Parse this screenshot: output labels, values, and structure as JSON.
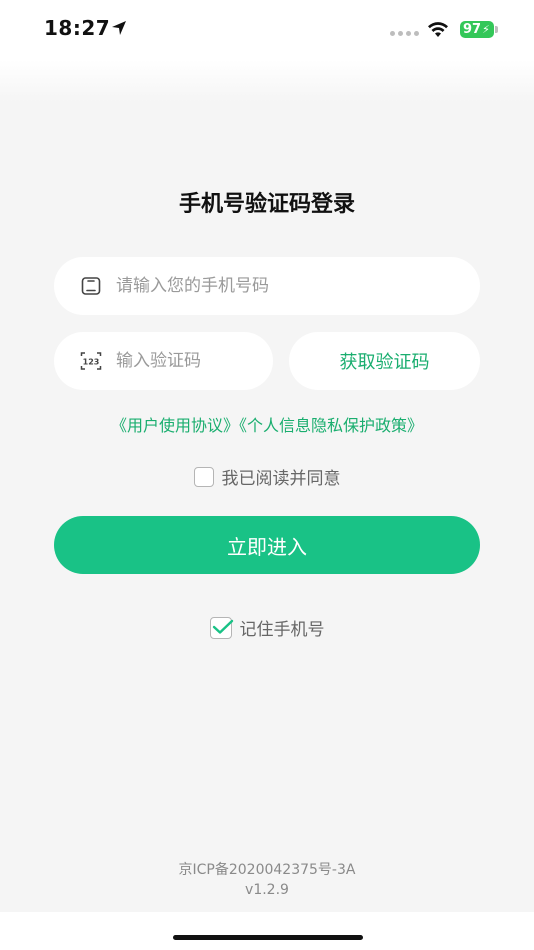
{
  "status_bar": {
    "time": "18:27",
    "battery": "97",
    "icons": [
      "location-arrow-icon",
      "signal-dots-icon",
      "wifi-icon",
      "battery-charging-icon"
    ]
  },
  "login": {
    "title": "手机号验证码登录",
    "phone_placeholder": "请输入您的手机号码",
    "code_placeholder": "输入验证码",
    "get_code_label": "获取验证码",
    "user_agreement": "《用户使用协议》",
    "privacy_policy": "《个人信息隐私保护政策》",
    "agree_label": "我已阅读并同意",
    "enter_label": "立即进入",
    "remember_label": "记住手机号",
    "agree_checked": false,
    "remember_checked": true
  },
  "footer": {
    "icp": "京ICP备2020042375号-3A",
    "version": "v1.2.9"
  },
  "colors": {
    "accent": "#19c286",
    "link": "#1aae6f",
    "background": "#f5f5f5"
  }
}
